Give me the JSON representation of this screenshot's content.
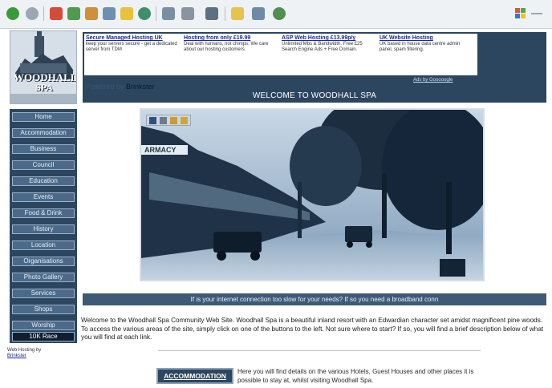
{
  "toolbar": {
    "icons": [
      "back-icon",
      "forward-icon",
      "stop-icon",
      "refresh-icon",
      "home-icon",
      "search-icon",
      "favorites-icon",
      "history-icon",
      "mail-icon",
      "print-icon",
      "edit-icon",
      "discuss-icon",
      "folder-icon",
      "window-icon",
      "messenger-icon"
    ]
  },
  "logo": {
    "text_line1": "WOODHALL",
    "text_line2": "SPA"
  },
  "nav": {
    "items": [
      "Home",
      "Accommodation",
      "Business",
      "Council",
      "Education",
      "Events",
      "Food & Drink",
      "History",
      "Location",
      "Organisations",
      "Photo Gallery",
      "Services",
      "Shops",
      "Worship",
      "10K Race"
    ]
  },
  "sidebar_footer": {
    "prefix": "Web Hosting by",
    "link": "Brinkster"
  },
  "ads": [
    {
      "title": "Secure Managed Hosting UK",
      "body": "keep your servers secure - get a dedicated server from TDM"
    },
    {
      "title": "Hosting from only £19.99",
      "body": "Deal with humans, not chimps. We care about our hosting customers"
    },
    {
      "title": "ASP Web Hosting £13.99p/y",
      "body": "Unlimited Mbs & Bandwidth. Free £25 Search Engine Ads + Free Domain."
    },
    {
      "title": "UK Website Hosting",
      "body": "UK based in house data centre admin panel, spam filtering."
    }
  ],
  "ads_by": "Ads by Gooooogle",
  "banner": {
    "brinkster_prefix": "Powered by",
    "brinkster": "Brinkster",
    "welcome": "WELCOME TO WOODHALL SPA"
  },
  "photo": {
    "sign_text": "ARMACY"
  },
  "broadband": "If is your internet connection too slow for your needs? If so you need a broadband conn",
  "intro": "Welcome to the Woodhall Spa Community Web Site. Woodhall Spa is a beautiful inland resort with an Edwardian character set amidst magnificent pine woods. To access the various areas of the site, simply click on one of the buttons to the left. Not sure where to start? If so, you will find a brief description below of what you will find at each link.",
  "accommodation": {
    "button": "ACCOMMODATION",
    "text": "Here you will find details on the various Hotels, Guest Houses and other places it is possible to stay at, whilst visiting Woodhall Spa."
  },
  "colors": {
    "nav_bg": "#2c4660",
    "button_bg": "#4b6a89",
    "link": "#1626a6"
  }
}
